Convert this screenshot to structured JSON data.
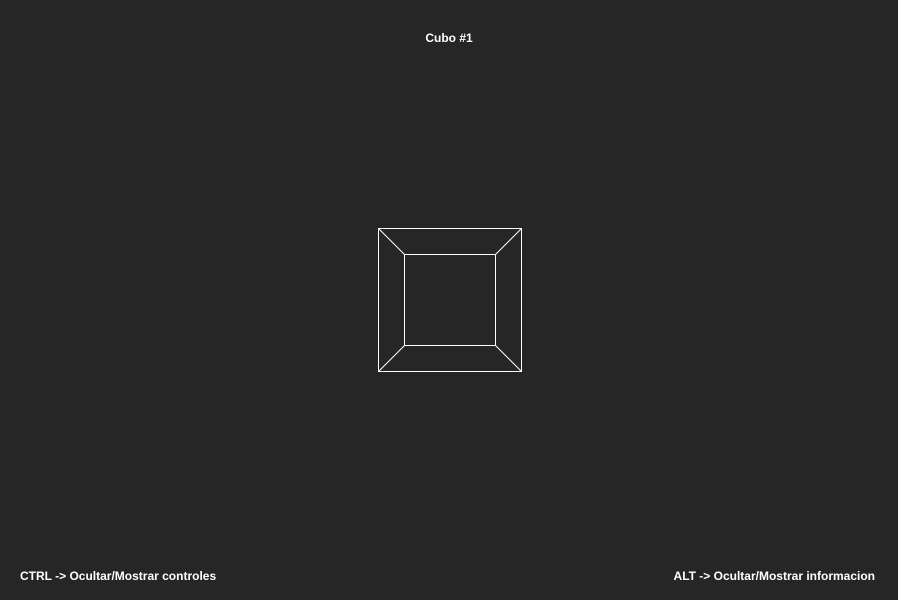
{
  "title": "Cubo #1",
  "controls": {
    "ctrl_hint": "CTRL -> Ocultar/Mostrar controles",
    "alt_hint": "ALT -> Ocultar/Mostrar informacion"
  },
  "colors": {
    "background": "#262626",
    "text": "#ffffff",
    "wireframe": "#ffffff"
  },
  "scene": {
    "object": "cube",
    "render_mode": "wireframe"
  }
}
